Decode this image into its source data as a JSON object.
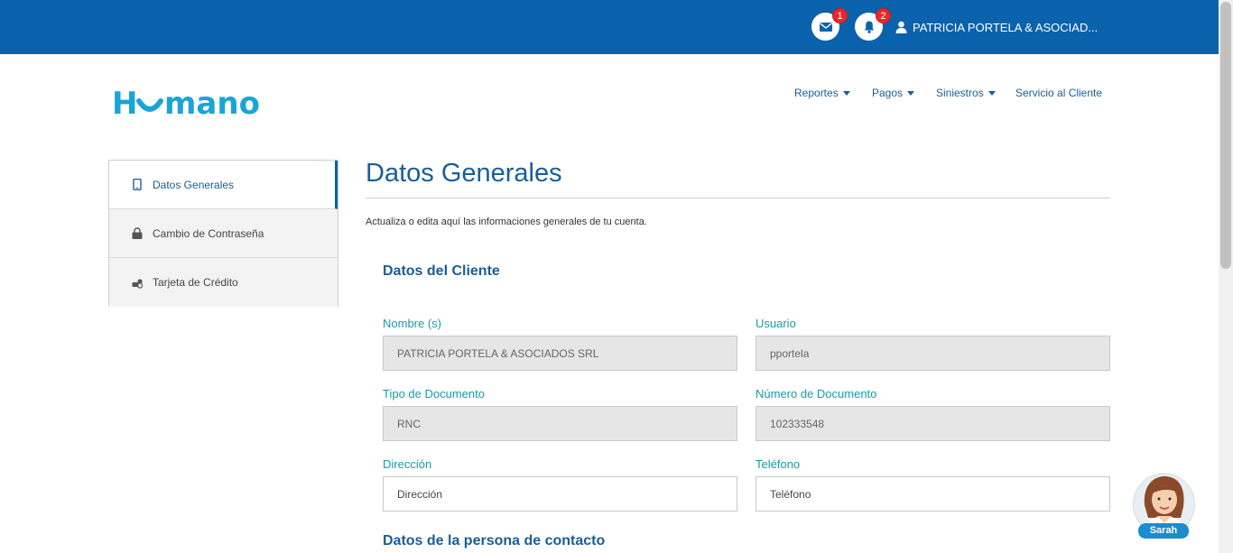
{
  "topbar": {
    "messages_count": "1",
    "notifications_count": "2",
    "user_name": "PATRICIA PORTELA & ASOCIAD..."
  },
  "header": {
    "logo_text": "Humano",
    "nav": [
      {
        "label": "Reportes",
        "dropdown": true
      },
      {
        "label": "Pagos",
        "dropdown": true
      },
      {
        "label": "Siniestros",
        "dropdown": true
      },
      {
        "label": "Servicio al Cliente",
        "dropdown": false
      }
    ]
  },
  "sidebar": {
    "items": [
      {
        "label": "Datos Generales",
        "icon": "mobile-icon",
        "active": true
      },
      {
        "label": "Cambio de Contraseña",
        "icon": "lock-icon",
        "active": false
      },
      {
        "label": "Tarjeta de Crédito",
        "icon": "credit-card-icon",
        "active": false
      }
    ]
  },
  "main": {
    "title": "Datos Generales",
    "intro": "Actualiza o edita aquí las informaciones generales de tu cuenta.",
    "section_client": "Datos del Cliente",
    "section_contact": "Datos de la persona de contacto",
    "fields": {
      "nombre": {
        "label": "Nombre (s)",
        "value": "PATRICIA PORTELA & ASOCIADOS SRL"
      },
      "usuario": {
        "label": "Usuario",
        "value": "pportela"
      },
      "tipo_documento": {
        "label": "Tipo de Documento",
        "value": "RNC"
      },
      "numero_documento": {
        "label": "Número de Documento",
        "value": "102333548"
      },
      "direccion": {
        "label": "Dirección",
        "placeholder": "Dirección"
      },
      "telefono": {
        "label": "Teléfono",
        "placeholder": "Teléfono"
      }
    }
  },
  "assistant": {
    "name": "Sarah"
  },
  "colors": {
    "brand_blue": "#0a62ac",
    "logo_cyan": "#1aa4d8",
    "label_teal": "#1a9aa8",
    "badge_red": "#e8262e"
  }
}
